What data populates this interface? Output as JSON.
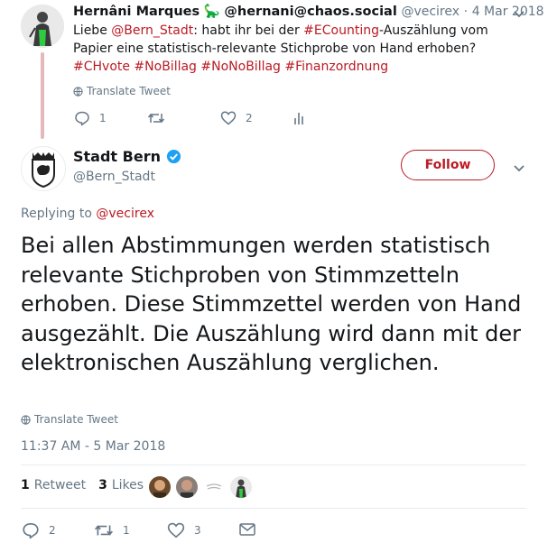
{
  "parent_tweet": {
    "name": "Hernâni Marques",
    "name_emoji": "🦕",
    "name_suffix": "@hernani@chaos.social",
    "handle": "@vecirex",
    "separator": "·",
    "date": "4 Mar 2018",
    "text_parts": [
      {
        "t": "Liebe ",
        "link": false
      },
      {
        "t": "@Bern_Stadt",
        "link": true
      },
      {
        "t": ": habt ihr bei der ",
        "link": false
      },
      {
        "t": "#ECounting",
        "link": true
      },
      {
        "t": "-Auszählung vom Papier eine statistisch-relevante Stichprobe von Hand erhoben?",
        "link": false
      }
    ],
    "hashtags": "#CHvote #NoBillag #NoNoBillag #Finanzordnung",
    "translate_label": "Translate Tweet",
    "reply_count": "1",
    "retweet_count": "",
    "like_count": "2"
  },
  "main_tweet": {
    "name": "Stadt Bern",
    "handle": "@Bern_Stadt",
    "follow_label": "Follow",
    "replying_prefix": "Replying to",
    "replying_to": "@vecirex",
    "text": "Bei allen Abstimmungen werden statistisch relevante Stichproben von Stimmzetteln erhoben. Diese Stimmzettel werden von Hand ausgezählt. Die Auszählung wird dann mit der elektronischen Auszählung verglichen.",
    "translate_label": "Translate Tweet",
    "timestamp": "11:37 AM - 5 Mar 2018",
    "retweets_count": "1",
    "retweets_label": "Retweet",
    "likes_count": "3",
    "likes_label": "Likes",
    "reply_count": "2",
    "retweet_count": "1",
    "like_count": "3"
  },
  "colors": {
    "accent": "#bb1a23",
    "muted": "#657786",
    "verified": "#1da1f2",
    "thread_line": "#e6b8bc"
  }
}
